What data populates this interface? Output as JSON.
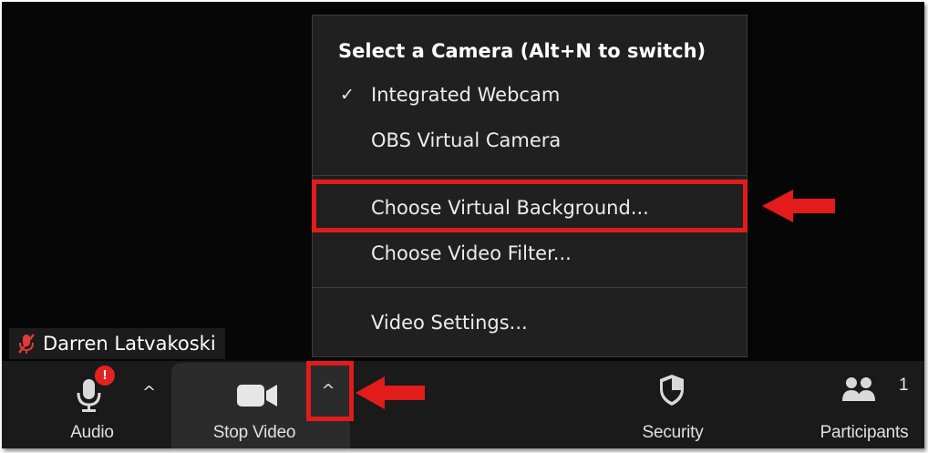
{
  "participant": {
    "name": "Darren Latvakoski",
    "muted_icon": "muted-mic-icon"
  },
  "toolbar": {
    "audio_label": "Audio",
    "audio_caret": "^",
    "stop_video_label": "Stop Video",
    "video_caret": "^",
    "security_label": "Security",
    "participants_label": "Participants",
    "participants_count": "1",
    "audio_alert_badge": "!"
  },
  "camera_menu": {
    "title": "Select a Camera (Alt+N to switch)",
    "check_mark": "✓",
    "items": [
      "Integrated Webcam",
      "OBS Virtual Camera",
      "Choose Virtual Background...",
      "Choose Video Filter...",
      "Video Settings..."
    ]
  },
  "colors": {
    "highlight": "#e21b1b",
    "background": "#040404",
    "toolbar": "#1a1a1a",
    "menu": "#202020",
    "alert_badge": "#e02424"
  }
}
